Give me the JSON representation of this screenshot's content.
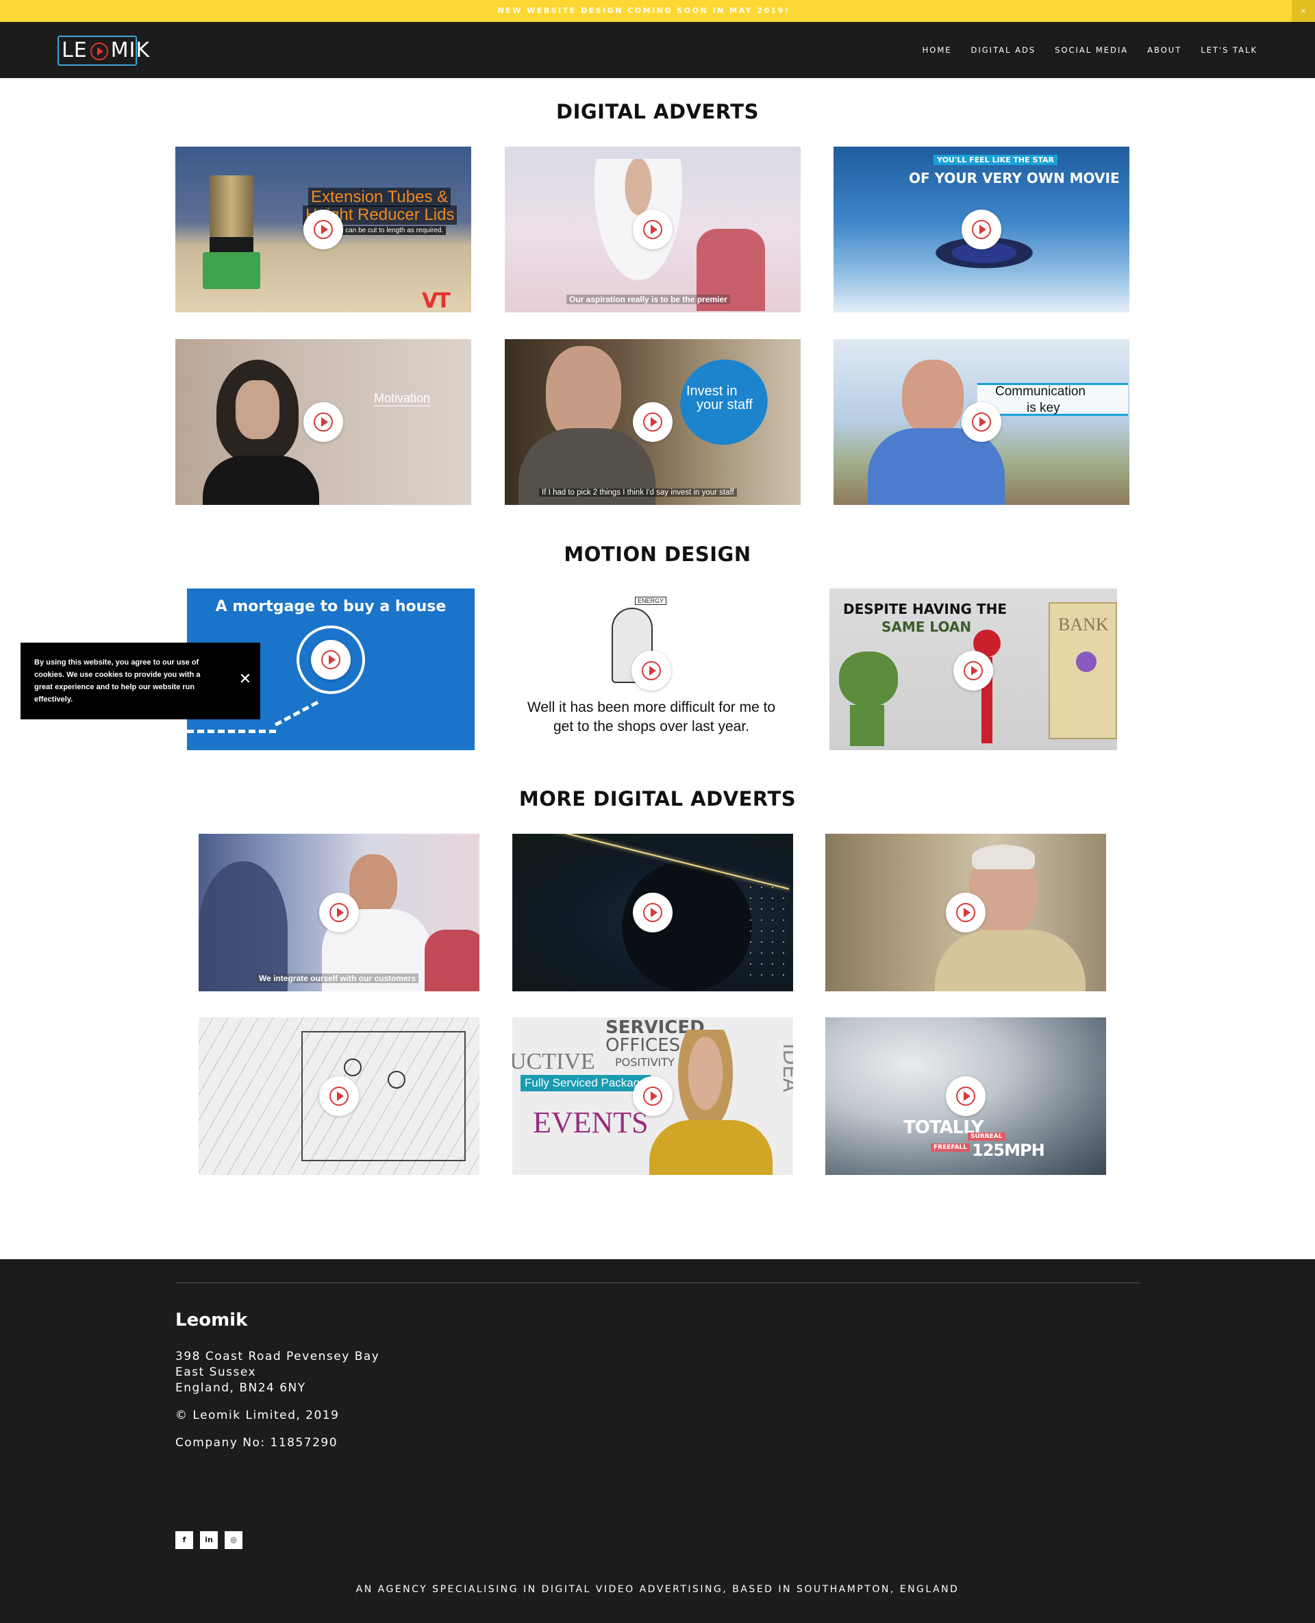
{
  "announcement": {
    "text": "NEW WEBSITE DESIGN COMING SOON IN MAY 2019!",
    "close": "×",
    "color": "#fdd835"
  },
  "header": {
    "logo": "LEOMIK",
    "nav": [
      "HOME",
      "DIGITAL ADS",
      "SOCIAL MEDIA",
      "ABOUT",
      "LET'S TALK"
    ]
  },
  "sections": {
    "digital_adverts": "DIGITAL ADVERTS",
    "motion_design": "MOTION DESIGN",
    "more_digital_adverts": "MORE DIGITAL ADVERTS"
  },
  "videos": {
    "v1": {
      "line1": "Extension Tubes &",
      "line2": "Height Reducer Lids",
      "line3": "Tubes can be cut to length as required.",
      "badge": "VT"
    },
    "v2": {
      "caption": "Our aspiration really is to be the premier"
    },
    "v3": {
      "tag": "YOU'LL FEEL LIKE THE STAR",
      "headline": "OF YOUR VERY OWN MOVIE"
    },
    "v4": {
      "word": "Motivation"
    },
    "v5": {
      "bubble1": "Invest in",
      "bubble2": "your staff",
      "caption": "If I had to pick 2 things I think I'd say invest in your staff"
    },
    "v6": {
      "line1": "Communication",
      "line2": "is key"
    },
    "m1": {
      "title": "A mortgage to buy a house"
    },
    "m2": {
      "label": "ENERGY",
      "line1": "Well it has been more difficult for me to",
      "line2": "get to the shops over last year."
    },
    "m3": {
      "line1": "DESPITE HAVING THE",
      "line2": "SAME LOAN",
      "sign": "BANK"
    },
    "d1": {
      "caption": "We integrate ourself with our customers"
    },
    "d5": {
      "words1": "SERVICED",
      "words2": "OFFICES",
      "words3": "POSITIVITY",
      "words4": "EVENTS",
      "words5": "IDEA",
      "words6": "UCTIVE",
      "label": "Fully Serviced Package"
    },
    "d6": {
      "big1": "TOTALLY",
      "tag1": "SURREAL",
      "tag2": "FREEFALL",
      "big2": "125MPH"
    }
  },
  "cookie": {
    "text": "By using this website, you agree to our use of cookies. We use cookies to provide you with a great experience and to help our website run effectively.",
    "close": "✕"
  },
  "footer": {
    "brand": "Leomik",
    "address1": "398 Coast Road Pevensey Bay",
    "address2": "East Sussex",
    "address3": "England, BN24 6NY",
    "copyright": "© Leomik Limited, 2019",
    "company": "Company No: 11857290",
    "social": [
      "f",
      "in",
      "◎"
    ],
    "tagline": "AN AGENCY SPECIALISING IN DIGITAL VIDEO ADVERTISING, BASED IN SOUTHAMPTON, ENGLAND"
  }
}
